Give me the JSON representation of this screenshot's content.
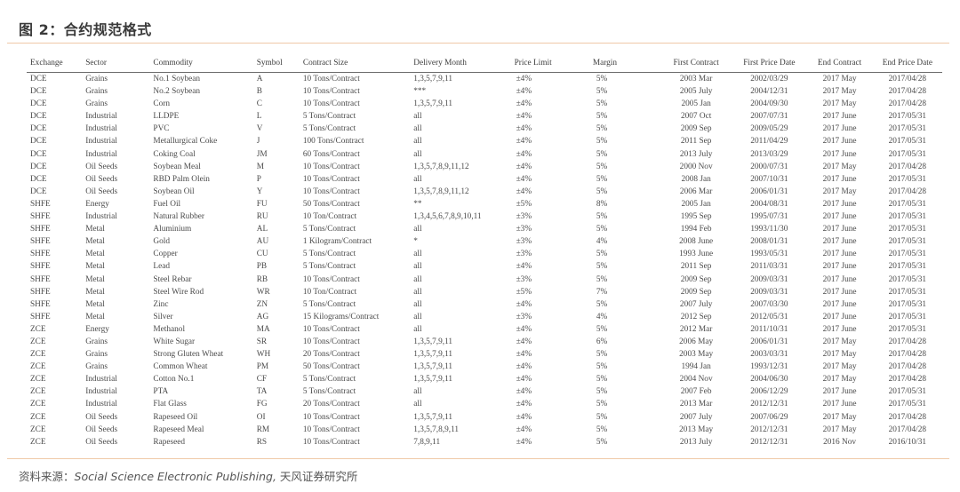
{
  "title": "图 2：合约规范格式",
  "source": {
    "label": "资料来源：",
    "publisher": "Social Science Electronic Publishing,",
    "org": " 天风证券研究所"
  },
  "colors": {
    "accent_rule": "#efc9a8",
    "text": "#4a4a4a"
  },
  "table": {
    "headers": [
      "Exchange",
      "Sector",
      "Commodity",
      "Symbol",
      "Contract Size",
      "Delivery Month",
      "Price Limit",
      "Margin",
      "First Contract",
      "First Price Date",
      "End Contract",
      "End Price Date"
    ],
    "rows": [
      [
        "DCE",
        "Grains",
        "No.1 Soybean",
        "A",
        "10 Tons/Contract",
        "1,3,5,7,9,11",
        "±4%",
        "5%",
        "2003 Mar",
        "2002/03/29",
        "2017 May",
        "2017/04/28"
      ],
      [
        "DCE",
        "Grains",
        "No.2 Soybean",
        "B",
        "10 Tons/Contract",
        "***",
        "±4%",
        "5%",
        "2005 July",
        "2004/12/31",
        "2017 May",
        "2017/04/28"
      ],
      [
        "DCE",
        "Grains",
        "Corn",
        "C",
        "10 Tons/Contract",
        "1,3,5,7,9,11",
        "±4%",
        "5%",
        "2005 Jan",
        "2004/09/30",
        "2017 May",
        "2017/04/28"
      ],
      [
        "DCE",
        "Industrial",
        "LLDPE",
        "L",
        "5 Tons/Contract",
        "all",
        "±4%",
        "5%",
        "2007 Oct",
        "2007/07/31",
        "2017 June",
        "2017/05/31"
      ],
      [
        "DCE",
        "Industrial",
        "PVC",
        "V",
        "5 Tons/Contract",
        "all",
        "±4%",
        "5%",
        "2009 Sep",
        "2009/05/29",
        "2017 June",
        "2017/05/31"
      ],
      [
        "DCE",
        "Industrial",
        "Metallurgical Coke",
        "J",
        "100 Tons/Contract",
        "all",
        "±4%",
        "5%",
        "2011 Sep",
        "2011/04/29",
        "2017 June",
        "2017/05/31"
      ],
      [
        "DCE",
        "Industrial",
        "Coking Coal",
        "JM",
        "60 Tons/Contract",
        "all",
        "±4%",
        "5%",
        "2013 July",
        "2013/03/29",
        "2017 June",
        "2017/05/31"
      ],
      [
        "DCE",
        "Oil Seeds",
        "Soybean Meal",
        "M",
        "10 Tons/Contract",
        "1,3,5,7,8,9,11,12",
        "±4%",
        "5%",
        "2000 Nov",
        "2000/07/31",
        "2017 May",
        "2017/04/28"
      ],
      [
        "DCE",
        "Oil Seeds",
        "RBD Palm Olein",
        "P",
        "10 Tons/Contract",
        "all",
        "±4%",
        "5%",
        "2008 Jan",
        "2007/10/31",
        "2017 June",
        "2017/05/31"
      ],
      [
        "DCE",
        "Oil Seeds",
        "Soybean Oil",
        "Y",
        "10 Tons/Contract",
        "1,3,5,7,8,9,11,12",
        "±4%",
        "5%",
        "2006 Mar",
        "2006/01/31",
        "2017 May",
        "2017/04/28"
      ],
      [
        "SHFE",
        "Energy",
        "Fuel Oil",
        "FU",
        "50 Tons/Contract",
        "**",
        "±5%",
        "8%",
        "2005 Jan",
        "2004/08/31",
        "2017 June",
        "2017/05/31"
      ],
      [
        "SHFE",
        "Industrial",
        "Natural Rubber",
        "RU",
        "10 Ton/Contract",
        "1,3,4,5,6,7,8,9,10,11",
        "±3%",
        "5%",
        "1995 Sep",
        "1995/07/31",
        "2017 June",
        "2017/05/31"
      ],
      [
        "SHFE",
        "Metal",
        "Aluminium",
        "AL",
        "5 Tons/Contract",
        "all",
        "±3%",
        "5%",
        "1994 Feb",
        "1993/11/30",
        "2017 June",
        "2017/05/31"
      ],
      [
        "SHFE",
        "Metal",
        "Gold",
        "AU",
        "1 Kilogram/Contract",
        "*",
        "±3%",
        "4%",
        "2008 June",
        "2008/01/31",
        "2017 June",
        "2017/05/31"
      ],
      [
        "SHFE",
        "Metal",
        "Copper",
        "CU",
        "5 Tons/Contract",
        "all",
        "±3%",
        "5%",
        "1993 June",
        "1993/05/31",
        "2017 June",
        "2017/05/31"
      ],
      [
        "SHFE",
        "Metal",
        "Lead",
        "PB",
        "5 Tons/Contract",
        "all",
        "±4%",
        "5%",
        "2011 Sep",
        "2011/03/31",
        "2017 June",
        "2017/05/31"
      ],
      [
        "SHFE",
        "Metal",
        "Steel Rebar",
        "RB",
        "10 Tons/Contract",
        "all",
        "±3%",
        "5%",
        "2009 Sep",
        "2009/03/31",
        "2017 June",
        "2017/05/31"
      ],
      [
        "SHFE",
        "Metal",
        "Steel Wire Rod",
        "WR",
        "10 Ton/Contract",
        "all",
        "±5%",
        "7%",
        "2009 Sep",
        "2009/03/31",
        "2017 June",
        "2017/05/31"
      ],
      [
        "SHFE",
        "Metal",
        "Zinc",
        "ZN",
        "5 Tons/Contract",
        "all",
        "±4%",
        "5%",
        "2007 July",
        "2007/03/30",
        "2017 June",
        "2017/05/31"
      ],
      [
        "SHFE",
        "Metal",
        "Silver",
        "AG",
        "15 Kilograms/Contract",
        "all",
        "±3%",
        "4%",
        "2012 Sep",
        "2012/05/31",
        "2017 June",
        "2017/05/31"
      ],
      [
        "ZCE",
        "Energy",
        "Methanol",
        "MA",
        "10 Tons/Contract",
        "all",
        "±4%",
        "5%",
        "2012 Mar",
        "2011/10/31",
        "2017 June",
        "2017/05/31"
      ],
      [
        "ZCE",
        "Grains",
        "White Sugar",
        "SR",
        "10 Tons/Contract",
        "1,3,5,7,9,11",
        "±4%",
        "6%",
        "2006 May",
        "2006/01/31",
        "2017 May",
        "2017/04/28"
      ],
      [
        "ZCE",
        "Grains",
        "Strong Gluten Wheat",
        "WH",
        "20 Tons/Contract",
        "1,3,5,7,9,11",
        "±4%",
        "5%",
        "2003 May",
        "2003/03/31",
        "2017 May",
        "2017/04/28"
      ],
      [
        "ZCE",
        "Grains",
        "Common Wheat",
        "PM",
        "50 Tons/Contract",
        "1,3,5,7,9,11",
        "±4%",
        "5%",
        "1994 Jan",
        "1993/12/31",
        "2017 May",
        "2017/04/28"
      ],
      [
        "ZCE",
        "Industrial",
        "Cotton No.1",
        "CF",
        "5 Tons/Contract",
        "1,3,5,7,9,11",
        "±4%",
        "5%",
        "2004 Nov",
        "2004/06/30",
        "2017 May",
        "2017/04/28"
      ],
      [
        "ZCE",
        "Industrial",
        "PTA",
        "TA",
        "5 Tons/Contract",
        "all",
        "±4%",
        "5%",
        "2007 Feb",
        "2006/12/29",
        "2017 June",
        "2017/05/31"
      ],
      [
        "ZCE",
        "Industrial",
        "Flat Glass",
        "FG",
        "20 Tons/Contract",
        "all",
        "±4%",
        "5%",
        "2013 Mar",
        "2012/12/31",
        "2017 June",
        "2017/05/31"
      ],
      [
        "ZCE",
        "Oil Seeds",
        "Rapeseed Oil",
        "OI",
        "10 Tons/Contract",
        "1,3,5,7,9,11",
        "±4%",
        "5%",
        "2007 July",
        "2007/06/29",
        "2017 May",
        "2017/04/28"
      ],
      [
        "ZCE",
        "Oil Seeds",
        "Rapeseed Meal",
        "RM",
        "10 Tons/Contract",
        "1,3,5,7,8,9,11",
        "±4%",
        "5%",
        "2013 May",
        "2012/12/31",
        "2017 May",
        "2017/04/28"
      ],
      [
        "ZCE",
        "Oil Seeds",
        "Rapeseed",
        "RS",
        "10 Tons/Contract",
        "7,8,9,11",
        "±4%",
        "5%",
        "2013 July",
        "2012/12/31",
        "2016 Nov",
        "2016/10/31"
      ]
    ]
  }
}
